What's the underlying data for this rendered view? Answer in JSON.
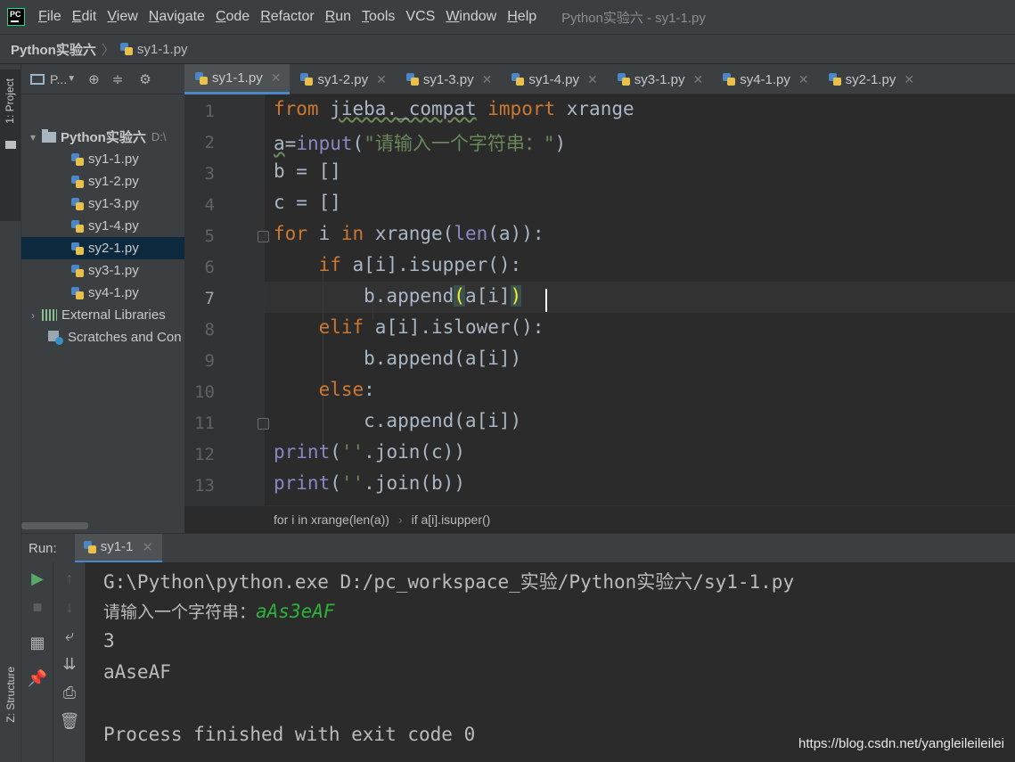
{
  "menubar": {
    "items": [
      {
        "key": "F",
        "rest": "ile"
      },
      {
        "key": "E",
        "rest": "dit"
      },
      {
        "key": "V",
        "rest": "iew"
      },
      {
        "key": "N",
        "rest": "avigate"
      },
      {
        "key": "C",
        "rest": "ode"
      },
      {
        "key": "R",
        "rest": "efactor"
      },
      {
        "key": "R",
        "rest": "un",
        "pre": ""
      },
      {
        "key": "T",
        "rest": "ools"
      },
      {
        "key": "",
        "rest": "VCS"
      },
      {
        "key": "W",
        "rest": "indow"
      },
      {
        "key": "H",
        "rest": "elp"
      }
    ],
    "window_title": "Python实验六 - sy1-1.py",
    "logo_text": "PC"
  },
  "navbar": {
    "project": "Python实验六",
    "separator": "〉",
    "file": "sy1-1.py"
  },
  "left_strip": {
    "project_label": "1: Project",
    "structure_label": "Z: Structure"
  },
  "project_panel": {
    "view_selector": "P...",
    "root": {
      "name": "Python实验六",
      "path": "D:\\"
    },
    "files": [
      "sy1-1.py",
      "sy1-2.py",
      "sy1-3.py",
      "sy1-4.py",
      "sy2-1.py",
      "sy3-1.py",
      "sy4-1.py"
    ],
    "selected_file": "sy2-1.py",
    "external_libraries": "External Libraries",
    "scratches": "Scratches and Con"
  },
  "editor_tabs": [
    "sy1-1.py",
    "sy1-2.py",
    "sy1-3.py",
    "sy1-4.py",
    "sy3-1.py",
    "sy4-1.py",
    "sy2-1.py"
  ],
  "active_tab": "sy1-1.py",
  "code": {
    "line_numbers": [
      "1",
      "2",
      "3",
      "4",
      "5",
      "6",
      "7",
      "8",
      "9",
      "10",
      "11",
      "12",
      "13"
    ],
    "current_line": "7"
  },
  "breadcrumbs": [
    "for i in xrange(len(a))",
    "if a[i].isupper()"
  ],
  "run": {
    "label": "Run:",
    "tab": "sy1-1",
    "console": {
      "command": "G:\\Python\\python.exe D:/pc_workspace_实验/Python实验六/sy1-1.py",
      "prompt": "请输入一个字符串：",
      "user_input": "aAs3eAF",
      "out1": "3",
      "out2": "aAseAF",
      "finished": "Process finished with exit code 0"
    }
  },
  "watermark": "https://blog.csdn.net/yangleileileilei",
  "colors": {
    "keyword": "#cc7832",
    "builtin": "#8888c6",
    "string": "#6a8759",
    "accent": "#4a88c7",
    "input_green": "#2db13d"
  }
}
